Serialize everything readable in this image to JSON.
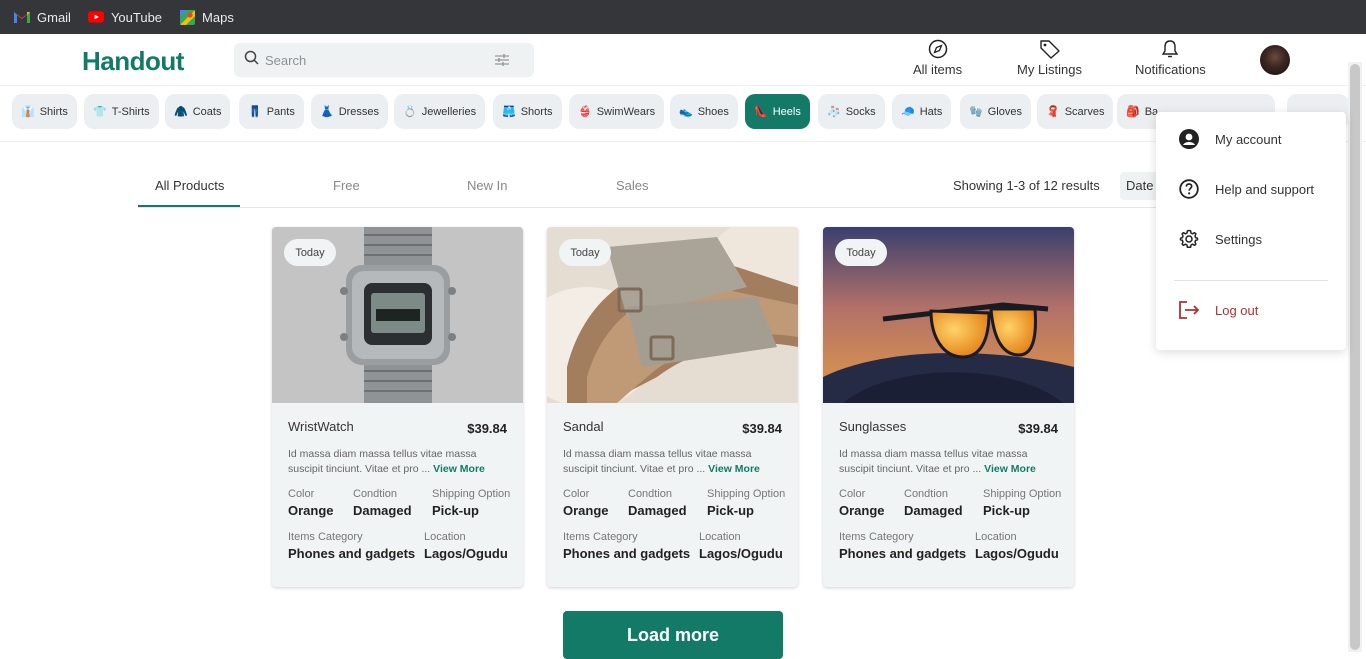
{
  "bookmarks": [
    {
      "label": "Gmail",
      "icon": "gmail-icon"
    },
    {
      "label": "YouTube",
      "icon": "youtube-icon"
    },
    {
      "label": "Maps",
      "icon": "maps-icon"
    }
  ],
  "header": {
    "logo": "Handout",
    "search_placeholder": "Search",
    "nav": [
      {
        "label": "All items",
        "icon": "compass-icon"
      },
      {
        "label": "My Listings",
        "icon": "tag-icon"
      },
      {
        "label": "Notifications",
        "icon": "bell-icon"
      }
    ]
  },
  "categories": [
    {
      "label": "Shirts",
      "emoji": "👔"
    },
    {
      "label": "T-Shirts",
      "emoji": "👕"
    },
    {
      "label": "Coats",
      "emoji": "🧥"
    },
    {
      "label": "Pants",
      "emoji": "👖"
    },
    {
      "label": "Dresses",
      "emoji": "👗"
    },
    {
      "label": "Jewelleries",
      "emoji": "💍"
    },
    {
      "label": "Shorts",
      "emoji": "🩳"
    },
    {
      "label": "SwimWears",
      "emoji": "👙"
    },
    {
      "label": "Shoes",
      "emoji": "👟"
    },
    {
      "label": "Heels",
      "emoji": "👠",
      "active": true
    },
    {
      "label": "Socks",
      "emoji": "🧦"
    },
    {
      "label": "Hats",
      "emoji": "🧢"
    },
    {
      "label": "Gloves",
      "emoji": "🧤"
    },
    {
      "label": "Scarves",
      "emoji": "🧣"
    },
    {
      "label": "Ba",
      "emoji": "🎒"
    }
  ],
  "tabs": [
    {
      "label": "All Products",
      "active": true
    },
    {
      "label": "Free"
    },
    {
      "label": "New In"
    },
    {
      "label": "Sales"
    }
  ],
  "results": {
    "showing": "Showing 1-3 of 12 results",
    "sort": "Date A"
  },
  "products": [
    {
      "badge": "Today",
      "name": "WristWatch",
      "price": "$39.84",
      "desc": "Id massa diam massa tellus vitae massa suscipit tinciunt. Vitae et pro ...",
      "view_more": "View More",
      "color_label": "Color",
      "color": "Orange",
      "condition_label": "Condtion",
      "condition": "Damaged",
      "shipping_label": "Shipping Option",
      "shipping": "Pick-up",
      "category_label": "Items Category",
      "category": "Phones and gadgets",
      "location_label": "Location",
      "location": "Lagos/Ogudu"
    },
    {
      "badge": "Today",
      "name": "Sandal",
      "price": "$39.84",
      "desc": "Id massa diam massa tellus vitae massa suscipit tinciunt. Vitae et pro ...",
      "view_more": "View More",
      "color_label": "Color",
      "color": "Orange",
      "condition_label": "Condtion",
      "condition": "Damaged",
      "shipping_label": "Shipping Option",
      "shipping": "Pick-up",
      "category_label": "Items Category",
      "category": "Phones and gadgets",
      "location_label": "Location",
      "location": "Lagos/Ogudu"
    },
    {
      "badge": "Today",
      "name": "Sunglasses",
      "price": "$39.84",
      "desc": "Id massa diam massa tellus vitae massa suscipit tinciunt. Vitae et pro ...",
      "view_more": "View More",
      "color_label": "Color",
      "color": "Orange",
      "condition_label": "Condtion",
      "condition": "Damaged",
      "shipping_label": "Shipping Option",
      "shipping": "Pick-up",
      "category_label": "Items Category",
      "category": "Phones and gadgets",
      "location_label": "Location",
      "location": "Lagos/Ogudu"
    }
  ],
  "load_more": "Load more",
  "account_menu": [
    {
      "label": "My account",
      "icon": "user-circle-icon"
    },
    {
      "label": "Help and support",
      "icon": "help-circle-icon"
    },
    {
      "label": "Settings",
      "icon": "gear-icon"
    },
    {
      "label": "Log out",
      "icon": "logout-icon"
    }
  ],
  "colors": {
    "brand": "#137a68",
    "logout": "#a33333"
  }
}
